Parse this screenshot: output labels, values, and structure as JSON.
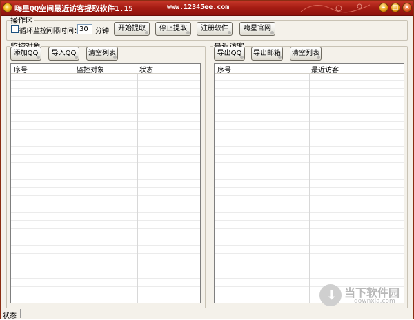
{
  "window": {
    "title": "嗨星QQ空间最近访客提取软件1.15",
    "url": "www.12345ee.com",
    "icons": {
      "app": "qq-star-icon",
      "minimize": "minimize-icon",
      "maximize": "maximize-icon",
      "close": "close-icon"
    }
  },
  "operation": {
    "legend": "操作区",
    "loop_label": "循环监控",
    "loop_checked": false,
    "interval_label": "间隔时间：",
    "interval_value": "30",
    "unit_label": "分钟",
    "buttons": {
      "start": "开始提取",
      "stop": "停止提取",
      "register": "注册软件",
      "website": "嗨星官网"
    }
  },
  "monitor": {
    "legend": "监控对象",
    "buttons": {
      "add": "添加QQ",
      "import": "导入QQ",
      "clear": "清空列表"
    },
    "columns": [
      "序号",
      "监控对象",
      "状态"
    ],
    "rows": []
  },
  "visitors": {
    "legend": "最近访客",
    "buttons": {
      "export_qq": "导出QQ",
      "export_mail": "导出邮箱",
      "clear": "清空列表"
    },
    "columns": [
      "序号",
      "最近访客"
    ],
    "rows": []
  },
  "status": {
    "text": "状态"
  },
  "watermark": {
    "main": "当下软件园",
    "sub": "downxia.com"
  },
  "colors": {
    "titlebar": "#a61d14",
    "window_bg": "#f4f1ea",
    "accent_orange": "#e79b13"
  }
}
